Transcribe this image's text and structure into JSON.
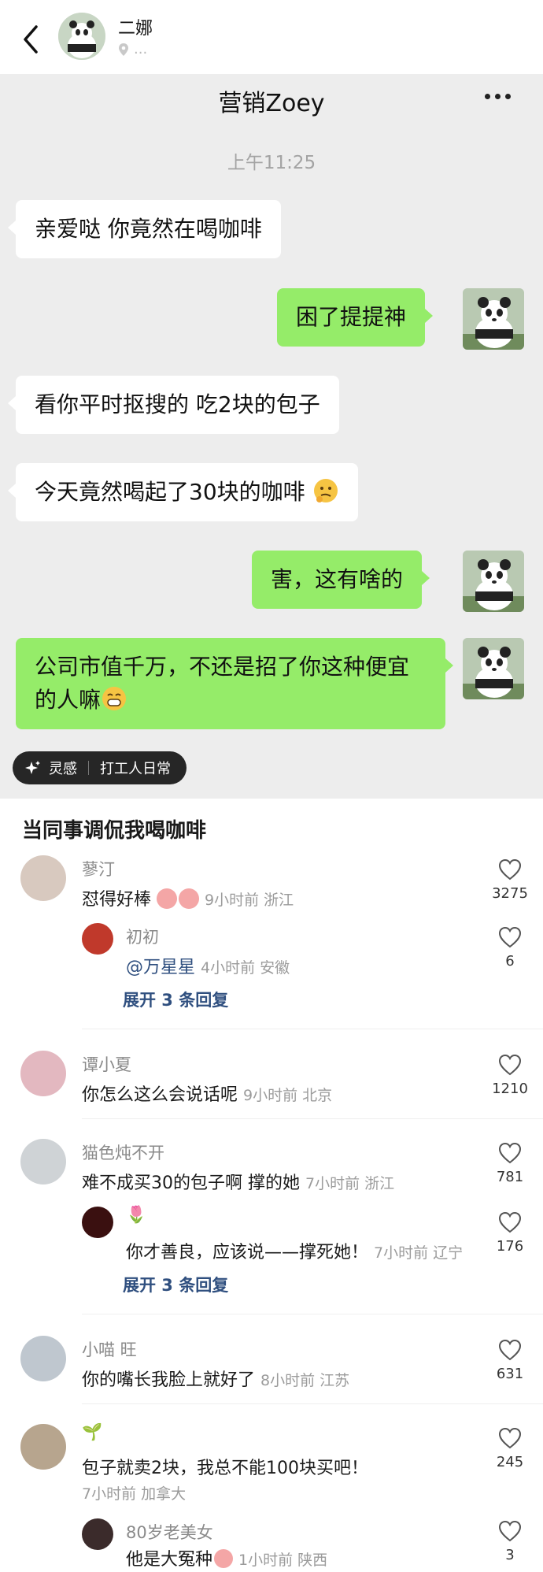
{
  "topbar": {
    "name": "二娜",
    "location": "..."
  },
  "chat": {
    "title": "营销Zoey",
    "time": "上午11:25",
    "messages": [
      {
        "side": "left",
        "text": "亲爱哒 你竟然在喝咖啡"
      },
      {
        "side": "right",
        "text": "困了提提神"
      },
      {
        "side": "left",
        "text": "看你平时抠搜的 吃2块的包子"
      },
      {
        "side": "left",
        "text": "今天竟然喝起了30块的咖啡"
      },
      {
        "side": "right",
        "text": "害，这有啥的"
      },
      {
        "side": "right",
        "text": "公司市值千万，不还是招了你这种便宜的人嘛"
      }
    ]
  },
  "tag": {
    "label1": "灵感",
    "label2": "打工人日常"
  },
  "post": {
    "title": "当同事调侃我喝咖啡"
  },
  "comments": [
    {
      "user": "蓼汀",
      "text": "怼得好棒",
      "time": "9小时前",
      "place": "浙江",
      "likes": "3275"
    },
    {
      "user": "初初",
      "text": "@万星星",
      "time": "4小时前",
      "place": "安徽",
      "likes": "6"
    },
    {
      "expand": "展开 3 条回复"
    },
    {
      "user": "谭小夏",
      "text": "你怎么这么会说话呢",
      "time": "9小时前",
      "place": "北京",
      "likes": "1210"
    },
    {
      "user": "猫色炖不开",
      "text": "难不成买30的包子啊 撑的她",
      "time": "7小时前",
      "place": "浙江",
      "likes": "781"
    },
    {
      "user": "🌷",
      "text": "你才善良，应该说——撑死她！",
      "time": "7小时前",
      "place": "辽宁",
      "likes": "176"
    },
    {
      "expand": "展开 3 条回复"
    },
    {
      "user": "小喵 旺",
      "text": "你的嘴长我脸上就好了",
      "time": "8小时前",
      "place": "江苏",
      "likes": "631"
    },
    {
      "user": "🌱",
      "text": "包子就卖2块，我总不能100块买吧！",
      "time": "7小时前",
      "place": "加拿大",
      "likes": "245"
    },
    {
      "user": "80岁老美女",
      "text": "他是大冤种",
      "time": "1小时前",
      "place": "陕西",
      "likes": "3"
    }
  ],
  "colors": {
    "bubble_green": "#95ec69",
    "chat_bg": "#ededed",
    "link": "#2f4f7f"
  }
}
